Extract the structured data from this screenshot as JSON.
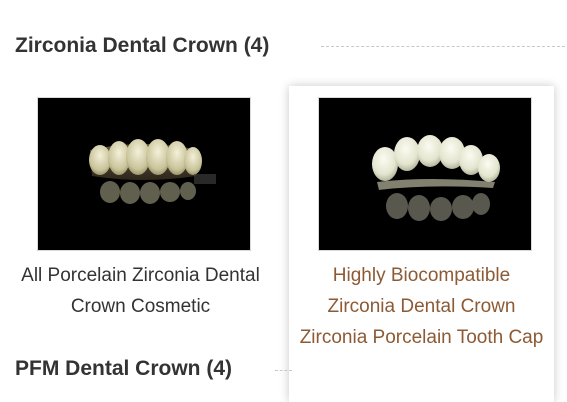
{
  "sections": [
    {
      "title": "Zirconia Dental Crown (4)"
    },
    {
      "title": "PFM Dental Crown (4)"
    }
  ],
  "products": [
    {
      "title": "All Porcelain Zirconia Dental Crown Cosmetic",
      "image_icon": "dental-crown-photo",
      "hovered": false
    },
    {
      "title": "Highly Biocompatible Zirconia Dental Crown Zirconia Porcelain Tooth Cap",
      "image_icon": "dental-crown-photo",
      "hovered": true
    }
  ],
  "colors": {
    "title_text": "#333333",
    "link_hover": "#8c5a34",
    "divider": "#c8c8c8",
    "image_background": "#000000"
  }
}
